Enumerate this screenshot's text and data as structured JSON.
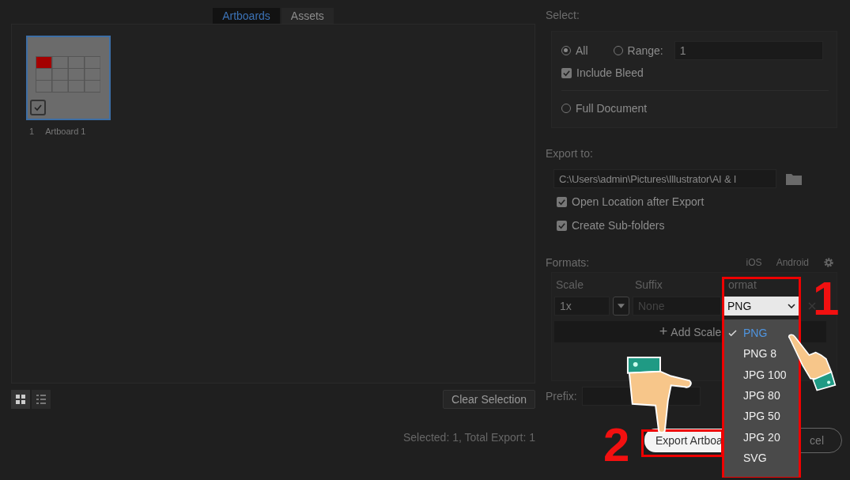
{
  "tabs": [
    {
      "label": "Artboards",
      "selected": true
    },
    {
      "label": "Assets",
      "selected": false
    }
  ],
  "artboards": [
    {
      "number": "1",
      "name": "Artboard 1",
      "checked": true
    }
  ],
  "clear_button": "Clear Selection",
  "status": "Selected: 1, Total Export: 1",
  "select": {
    "label": "Select:",
    "range_value": "1",
    "radios": [
      {
        "label": "All",
        "selected": true
      },
      {
        "label": "Range:",
        "selected": false
      },
      {
        "label": "Full Document",
        "selected": false
      }
    ],
    "include_bleed": {
      "label": "Include Bleed",
      "checked": true
    }
  },
  "export_to": {
    "label": "Export to:",
    "path": "C:\\Users\\admin\\Pictures\\Illustrator\\AI & I",
    "options": [
      {
        "label": "Open Location after Export",
        "checked": true
      },
      {
        "label": "Create Sub-folders",
        "checked": true
      }
    ]
  },
  "formats": {
    "label": "Formats:",
    "presets": [
      "iOS",
      "Android"
    ],
    "columns": [
      "Scale",
      "Suffix",
      "ormat"
    ],
    "scale": "1x",
    "suffix_placeholder": "None",
    "format": "PNG",
    "add_icon": "+",
    "add_button": "Add Scale",
    "menu": [
      {
        "label": "PNG",
        "selected": true
      },
      {
        "label": "PNG 8",
        "selected": false
      },
      {
        "label": "JPG 100",
        "selected": false
      },
      {
        "label": "JPG 80",
        "selected": false
      },
      {
        "label": "JPG 50",
        "selected": false
      },
      {
        "label": "JPG 20",
        "selected": false
      },
      {
        "label": "SVG",
        "selected": false
      }
    ]
  },
  "prefix_label": "Prefix:",
  "buttons": {
    "export": "Export Artboa",
    "cancel": "cel"
  },
  "annotations": [
    "1",
    "2"
  ]
}
